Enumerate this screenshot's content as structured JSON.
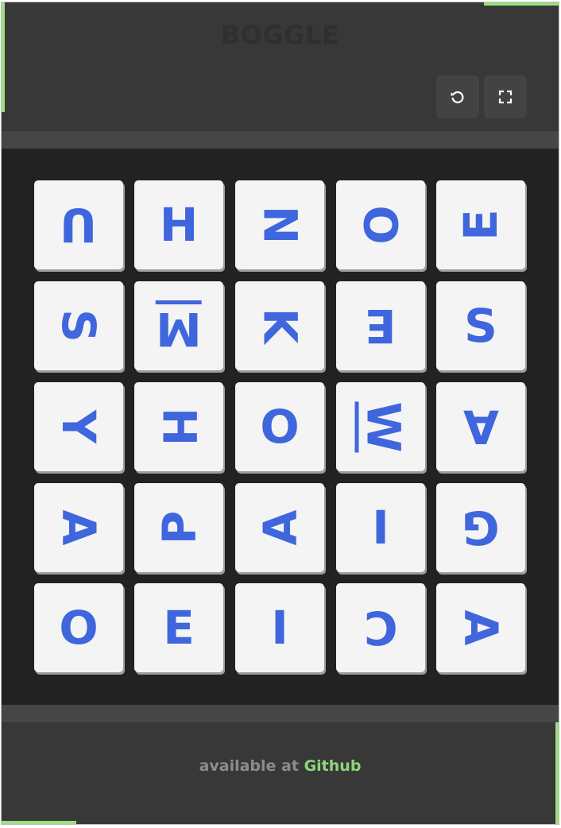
{
  "header": {
    "title": "BOGGLE"
  },
  "toolbar": {
    "restart": {
      "icon": "restart-icon"
    },
    "fullscreen": {
      "icon": "fullscreen-icon"
    }
  },
  "board": {
    "tiles": [
      {
        "letter": "U",
        "rotation": 180,
        "underline": false
      },
      {
        "letter": "H",
        "rotation": 0,
        "underline": false
      },
      {
        "letter": "N",
        "rotation": 90,
        "underline": false
      },
      {
        "letter": "O",
        "rotation": 90,
        "underline": false
      },
      {
        "letter": "E",
        "rotation": 270,
        "underline": false
      },
      {
        "letter": "S",
        "rotation": 90,
        "underline": false
      },
      {
        "letter": "M",
        "rotation": 180,
        "underline": true
      },
      {
        "letter": "K",
        "rotation": 90,
        "underline": false
      },
      {
        "letter": "E",
        "rotation": 180,
        "underline": false
      },
      {
        "letter": "S",
        "rotation": 0,
        "underline": false
      },
      {
        "letter": "Y",
        "rotation": 90,
        "underline": false
      },
      {
        "letter": "H",
        "rotation": 90,
        "underline": false
      },
      {
        "letter": "O",
        "rotation": 0,
        "underline": false
      },
      {
        "letter": "W",
        "rotation": 90,
        "underline": true
      },
      {
        "letter": "A",
        "rotation": 180,
        "underline": false
      },
      {
        "letter": "A",
        "rotation": 90,
        "underline": false
      },
      {
        "letter": "P",
        "rotation": 270,
        "underline": false
      },
      {
        "letter": "A",
        "rotation": 270,
        "underline": false
      },
      {
        "letter": "I",
        "rotation": 0,
        "underline": false
      },
      {
        "letter": "G",
        "rotation": 180,
        "underline": false
      },
      {
        "letter": "O",
        "rotation": 0,
        "underline": false
      },
      {
        "letter": "E",
        "rotation": 0,
        "underline": false
      },
      {
        "letter": "I",
        "rotation": 0,
        "underline": false
      },
      {
        "letter": "C",
        "rotation": 180,
        "underline": false
      },
      {
        "letter": "A",
        "rotation": 90,
        "underline": false
      }
    ]
  },
  "footer": {
    "prefix": "available at ",
    "link": "Github"
  },
  "colors": {
    "letter": "#3f66dc",
    "accent": "#9be07f",
    "tile": "#f4f4f4"
  }
}
